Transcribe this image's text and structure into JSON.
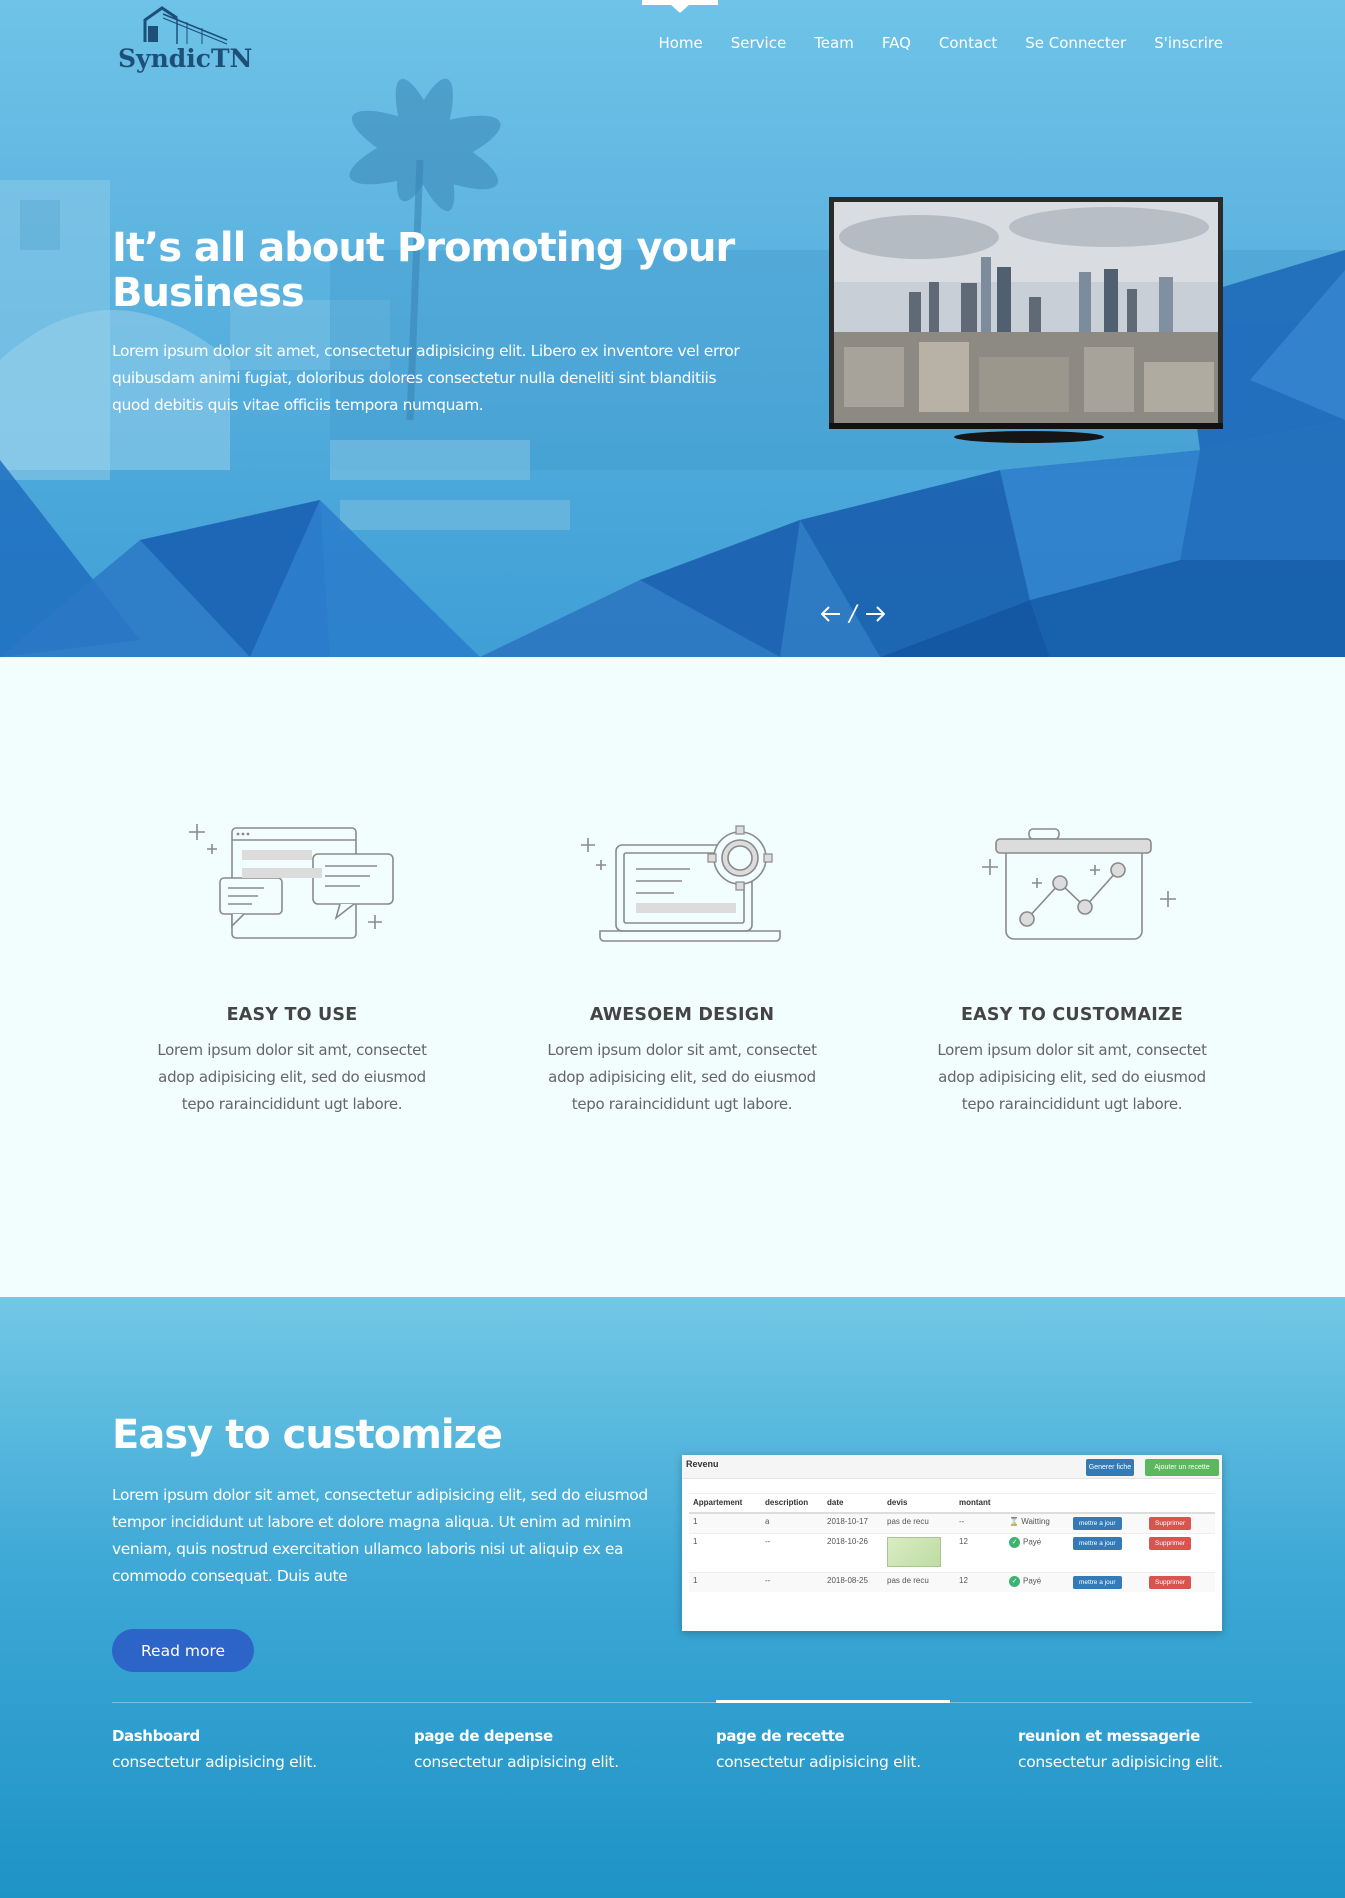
{
  "brand": {
    "logo_text": "SyndicTN"
  },
  "nav": {
    "items": [
      "Home",
      "Service",
      "Team",
      "FAQ",
      "Contact",
      "Se Connecter",
      "S'inscrire"
    ],
    "active": "Home"
  },
  "hero": {
    "title": "It’s all about Promoting your Business",
    "text": "Lorem ipsum dolor sit amet, consectetur adipisicing elit. Libero ex inventore vel error quibusdam animi fugiat, doloribus dolores consectetur nulla deneliti sint blanditiis quod debitis quis vitae officiis tempora numquam.",
    "slider_separator": "/"
  },
  "features": [
    {
      "title": "EASY TO USE",
      "text": "Lorem ipsum dolor sit amt, consectet adop adipisicing elit, sed do eiusmod tepo raraincididunt ugt labore.",
      "icon": "chat-window-icon"
    },
    {
      "title": "AWESOEM DESIGN",
      "text": "Lorem ipsum dolor sit amt, consectet adop adipisicing elit, sed do eiusmod tepo raraincididunt ugt labore.",
      "icon": "laptop-gear-icon"
    },
    {
      "title": "EASY TO CUSTOMAIZE",
      "text": "Lorem ipsum dolor sit amt, consectet adop adipisicing elit, sed do eiusmod tepo raraincididunt ugt labore.",
      "icon": "presentation-chart-icon"
    }
  ],
  "customize": {
    "title": "Easy to customize",
    "text": "Lorem ipsum dolor sit amet, consectetur adipisicing elit, sed do eiusmod tempor incididunt ut labore et dolore magna aliqua. Ut enim ad minim veniam, quis nostrud exercitation ullamco laboris nisi ut aliquip ex ea commodo consequat. Duis aute",
    "read_more": "Read more",
    "tabs": [
      {
        "title": "Dashboard",
        "desc": "consectetur adipisicing elit."
      },
      {
        "title": "page de depense",
        "desc": "consectetur adipisicing elit."
      },
      {
        "title": "page de recette",
        "desc": "consectetur adipisicing elit."
      },
      {
        "title": "reunion et messagerie",
        "desc": "consectetur adipisicing elit."
      }
    ],
    "active_tab": "page de recette"
  },
  "dashboard": {
    "title": "Revenu",
    "btn_generate": "Generer fiche",
    "btn_add": "Ajouter un recette",
    "columns": [
      "Appartement",
      "description",
      "date",
      "devis",
      "montant",
      "",
      "",
      ""
    ],
    "rows": [
      {
        "appartement": "1",
        "description": "a",
        "date": "2018-10-17",
        "devis": "pas de recu",
        "montant": "--",
        "status": "Waitting",
        "update": "mettre a jour",
        "delete": "Supprimer"
      },
      {
        "appartement": "1",
        "description": "--",
        "date": "2018-10-26",
        "devis": "",
        "montant": "12",
        "status": "Payé",
        "update": "mettre a jour",
        "delete": "Supprimer"
      },
      {
        "appartement": "1",
        "description": "--",
        "date": "2018-08-25",
        "devis": "pas de recu",
        "montant": "12",
        "status": "Payé",
        "update": "mettre a jour",
        "delete": "Supprimer"
      }
    ]
  },
  "colors": {
    "hero_top": "#6ec3e8",
    "accent_button": "#2d64c8",
    "brand_dark": "#1d4f78",
    "btn_blue": "#337ab7",
    "btn_green": "#5cb85c",
    "btn_red": "#d9534f"
  }
}
